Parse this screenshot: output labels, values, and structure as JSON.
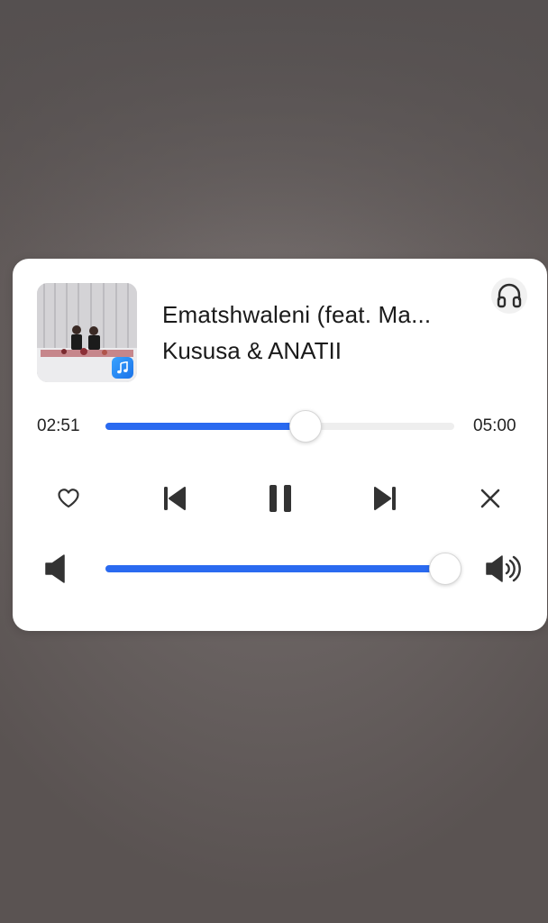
{
  "player": {
    "song_title": "Ematshwaleni (feat. Ma...",
    "artist": "Kususa & ANATII",
    "elapsed": "02:51",
    "duration": "05:00",
    "progress_fraction": 0.57,
    "volume_fraction": 1.0,
    "accent_color": "#2a6af0"
  },
  "icons": {
    "headphones": "headphones-icon",
    "favorite": "heart-icon",
    "previous": "skip-previous-icon",
    "pause": "pause-icon",
    "next": "skip-next-icon",
    "close": "close-icon",
    "volume_low": "volume-low-icon",
    "volume_high": "volume-high-icon",
    "music_app": "music-note-icon"
  }
}
